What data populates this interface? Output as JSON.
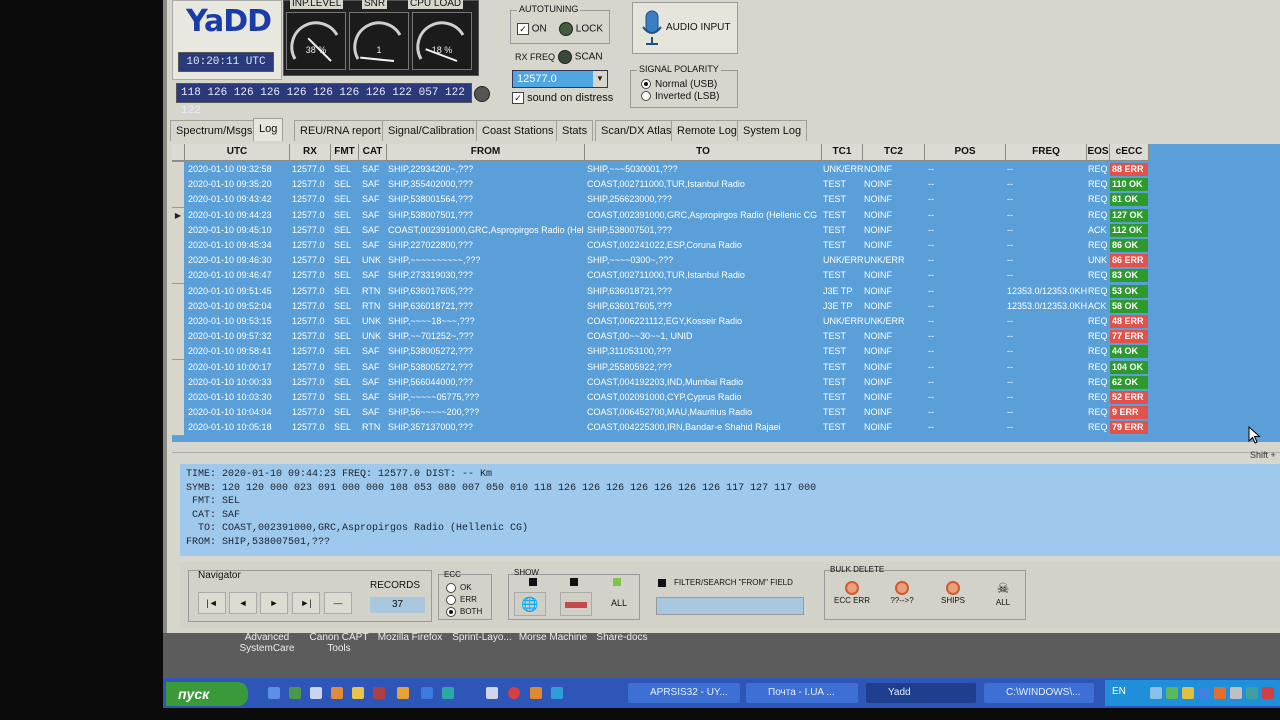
{
  "app": {
    "logo": "YaDD",
    "utc": "10:20:11 UTC",
    "symbols": "118 126 126 126 126 126 126 126 122 057 122 122"
  },
  "gauges": [
    {
      "label": "INP.LEVEL",
      "value": "38 %",
      "level": 0.38
    },
    {
      "label": "SNR",
      "value": "1",
      "level": 0.05
    },
    {
      "label": "CPU LOAD",
      "value": "18 %",
      "level": 0.18
    }
  ],
  "autotuning": {
    "title": "AUTOTUNING",
    "on_label": "ON",
    "lock_label": "LOCK"
  },
  "rx": {
    "freq_label": "RX FREQ",
    "scan_label": "SCAN",
    "freq_value": "12577.0",
    "distress_label": "sound on distress"
  },
  "audio": {
    "label": "AUDIO INPUT"
  },
  "polarity": {
    "title": "SIGNAL POLARITY",
    "normal": "Normal (USB)",
    "inverted": "Inverted (LSB)"
  },
  "tabs": [
    "Spectrum/Msgs",
    "Log",
    "REU/RNA report",
    "Signal/Calibration",
    "Coast Stations",
    "Stats",
    "Scan/DX Atlas",
    "Remote Log",
    "System Log"
  ],
  "columns": [
    "UTC",
    "RX",
    "FMT",
    "CAT",
    "FROM",
    "TO",
    "TC1",
    "TC2",
    "POS",
    "FREQ",
    "EOS",
    "cECC"
  ],
  "rows": [
    {
      "utc": "2020-01-10 09:32:58",
      "rx": "12577.0",
      "fmt": "SEL",
      "cat": "SAF",
      "from": "SHIP,22934200~,???",
      "to": "SHIP,~~~5030001,???",
      "tc1": "UNK/ERR",
      "tc2": "NOINF",
      "pos": "--",
      "freq": "--",
      "eos": "REQ",
      "ecc": "88 ERR",
      "ok": false
    },
    {
      "utc": "2020-01-10 09:35:20",
      "rx": "12577.0",
      "fmt": "SEL",
      "cat": "SAF",
      "from": "SHIP,355402000,???",
      "to": "COAST,002711000,TUR,Istanbul Radio",
      "tc1": "TEST",
      "tc2": "NOINF",
      "pos": "--",
      "freq": "--",
      "eos": "REQ",
      "ecc": "110 OK",
      "ok": true
    },
    {
      "utc": "2020-01-10 09:43:42",
      "rx": "12577.0",
      "fmt": "SEL",
      "cat": "SAF",
      "from": "SHIP,538001564,???",
      "to": "SHIP,256623000,???",
      "tc1": "TEST",
      "tc2": "NOINF",
      "pos": "--",
      "freq": "--",
      "eos": "REQ",
      "ecc": "81 OK",
      "ok": true
    },
    {
      "utc": "2020-01-10 09:44:23",
      "rx": "12577.0",
      "fmt": "SEL",
      "cat": "SAF",
      "from": "SHIP,538007501,???",
      "to": "COAST,002391000,GRC,Aspropirgos Radio (Hellenic CG",
      "tc1": "TEST",
      "tc2": "NOINF",
      "pos": "--",
      "freq": "--",
      "eos": "REQ",
      "ecc": "127 OK",
      "ok": true
    },
    {
      "utc": "2020-01-10 09:45:10",
      "rx": "12577.0",
      "fmt": "SEL",
      "cat": "SAF",
      "from": "COAST,002391000,GRC,Aspropirgos Radio (Hel",
      "to": "SHIP,538007501,???",
      "tc1": "TEST",
      "tc2": "NOINF",
      "pos": "--",
      "freq": "--",
      "eos": "ACK",
      "ecc": "112 OK",
      "ok": true
    },
    {
      "utc": "2020-01-10 09:45:34",
      "rx": "12577.0",
      "fmt": "SEL",
      "cat": "SAF",
      "from": "SHIP,227022800,???",
      "to": "COAST,002241022,ESP,Coruna Radio",
      "tc1": "TEST",
      "tc2": "NOINF",
      "pos": "--",
      "freq": "--",
      "eos": "REQ",
      "ecc": "86 OK",
      "ok": true
    },
    {
      "utc": "2020-01-10 09:46:30",
      "rx": "12577.0",
      "fmt": "SEL",
      "cat": "UNK",
      "from": "SHIP,~~~~~~~~~~,???",
      "to": "SHIP,~~~~0300~,???",
      "tc1": "UNK/ERR",
      "tc2": "UNK/ERR",
      "pos": "--",
      "freq": "--",
      "eos": "UNK",
      "ecc": "86 ERR",
      "ok": false
    },
    {
      "utc": "2020-01-10 09:46:47",
      "rx": "12577.0",
      "fmt": "SEL",
      "cat": "SAF",
      "from": "SHIP,273319030,???",
      "to": "COAST,002711000,TUR,Istanbul Radio",
      "tc1": "TEST",
      "tc2": "NOINF",
      "pos": "--",
      "freq": "--",
      "eos": "REQ",
      "ecc": "83 OK",
      "ok": true
    },
    {
      "utc": "2020-01-10 09:51:45",
      "rx": "12577.0",
      "fmt": "SEL",
      "cat": "RTN",
      "from": "SHIP,636017605,???",
      "to": "SHIP,636018721,???",
      "tc1": "J3E TP",
      "tc2": "NOINF",
      "pos": "--",
      "freq": "12353.0/12353.0KH",
      "eos": "REQ",
      "ecc": "53 OK",
      "ok": true
    },
    {
      "utc": "2020-01-10 09:52:04",
      "rx": "12577.0",
      "fmt": "SEL",
      "cat": "RTN",
      "from": "SHIP,636018721,???",
      "to": "SHIP,636017605,???",
      "tc1": "J3E TP",
      "tc2": "NOINF",
      "pos": "--",
      "freq": "12353.0/12353.0KH",
      "eos": "ACK",
      "ecc": "58 OK",
      "ok": true
    },
    {
      "utc": "2020-01-10 09:53:15",
      "rx": "12577.0",
      "fmt": "SEL",
      "cat": "UNK",
      "from": "SHIP,~~~~18~~~,???",
      "to": "COAST,006221112,EGY,Kosseir Radio",
      "tc1": "UNK/ERR",
      "tc2": "UNK/ERR",
      "pos": "--",
      "freq": "--",
      "eos": "REQ",
      "ecc": "48 ERR",
      "ok": false
    },
    {
      "utc": "2020-01-10 09:57:32",
      "rx": "12577.0",
      "fmt": "SEL",
      "cat": "UNK",
      "from": "SHIP,~~701252~,???",
      "to": "COAST,00~~30~~1, UNID",
      "tc1": "TEST",
      "tc2": "NOINF",
      "pos": "--",
      "freq": "--",
      "eos": "REQ",
      "ecc": "77 ERR",
      "ok": false
    },
    {
      "utc": "2020-01-10 09:58:41",
      "rx": "12577.0",
      "fmt": "SEL",
      "cat": "SAF",
      "from": "SHIP,538005272,???",
      "to": "SHIP,311053100,???",
      "tc1": "TEST",
      "tc2": "NOINF",
      "pos": "--",
      "freq": "--",
      "eos": "REQ",
      "ecc": "44 OK",
      "ok": true
    },
    {
      "utc": "2020-01-10 10:00:17",
      "rx": "12577.0",
      "fmt": "SEL",
      "cat": "SAF",
      "from": "SHIP,538005272,???",
      "to": "SHIP,255805922,???",
      "tc1": "TEST",
      "tc2": "NOINF",
      "pos": "--",
      "freq": "--",
      "eos": "REQ",
      "ecc": "104 OK",
      "ok": true
    },
    {
      "utc": "2020-01-10 10:00:33",
      "rx": "12577.0",
      "fmt": "SEL",
      "cat": "SAF",
      "from": "SHIP,566044000,???",
      "to": "COAST,004192203,IND,Mumbai Radio",
      "tc1": "TEST",
      "tc2": "NOINF",
      "pos": "--",
      "freq": "--",
      "eos": "REQ",
      "ecc": "62 OK",
      "ok": true
    },
    {
      "utc": "2020-01-10 10:03:30",
      "rx": "12577.0",
      "fmt": "SEL",
      "cat": "SAF",
      "from": "SHIP,~~~~~05775,???",
      "to": "COAST,002091000,CYP,Cyprus Radio",
      "tc1": "TEST",
      "tc2": "NOINF",
      "pos": "--",
      "freq": "--",
      "eos": "REQ",
      "ecc": "52 ERR",
      "ok": false
    },
    {
      "utc": "2020-01-10 10:04:04",
      "rx": "12577.0",
      "fmt": "SEL",
      "cat": "SAF",
      "from": "SHIP,56~~~~~200,???",
      "to": "COAST,006452700,MAU,Mauritius Radio",
      "tc1": "TEST",
      "tc2": "NOINF",
      "pos": "--",
      "freq": "--",
      "eos": "REQ",
      "ecc": "9 ERR",
      "ok": false
    },
    {
      "utc": "2020-01-10 10:05:18",
      "rx": "12577.0",
      "fmt": "SEL",
      "cat": "RTN",
      "from": "SHIP,357137000,???",
      "to": "COAST,004225300,IRN,Bandar-e Shahid Rajaei",
      "tc1": "TEST",
      "tc2": "NOINF",
      "pos": "--",
      "freq": "--",
      "eos": "REQ",
      "ecc": "79 ERR",
      "ok": false
    }
  ],
  "detail": {
    "time": "TIME: 2020-01-10 09:44:23 FREQ: 12577.0 DIST: -- Km",
    "symb": "SYMB: 120 120 000 023 091 000 000 108 053 080 007 050 010 118 126 126 126 126 126 126 126 117 127 117 000",
    "fmt": " FMT: SEL",
    "cat": " CAT: SAF",
    "to": "  TO: COAST,002391000,GRC,Aspropirgos Radio (Hellenic CG)",
    "from": "FROM: SHIP,538007501,???"
  },
  "navigator": {
    "title": "Navigator",
    "records_label": "RECORDS",
    "records_value": "37",
    "buttons": [
      "|◄",
      "◄",
      "►",
      "►|",
      "—"
    ]
  },
  "ecc_filter": {
    "title": "ECC",
    "ok": "OK",
    "err": "ERR",
    "both": "BOTH"
  },
  "show": {
    "title": "SHOW",
    "all": "ALL",
    "filter_label": "FILTER/SEARCH \"FROM\" FIELD"
  },
  "bulk": {
    "title": "BULK DELETE",
    "ecc_err": "ECC ERR",
    "unknown": "??-->?",
    "ships": "SHIPS",
    "all": "ALL"
  },
  "desktop": {
    "icon1_line1": "Advanced",
    "icon1_line2": "SystemCare",
    "icon2_line1": "Canon CAPT",
    "icon2_line2": "Tools",
    "icon3": "Mozilla Firefox",
    "icon4": "Sprint-Layo...",
    "icon5": "Morse Machine",
    "icon6": "Share-docs"
  },
  "taskbar": {
    "start": "пуск",
    "tasks": [
      "APRSIS32 - UY...",
      "Почта - I.UA ...",
      "Yadd",
      "C:\\WINDOWS\\..."
    ],
    "lang": "EN"
  },
  "misc": {
    "shift": "Shift +"
  },
  "colors": {
    "grid_bg": "#5a9fd8",
    "ok": "#2e9a2e",
    "err": "#e0524a",
    "taskbar": "#2d56b8"
  }
}
